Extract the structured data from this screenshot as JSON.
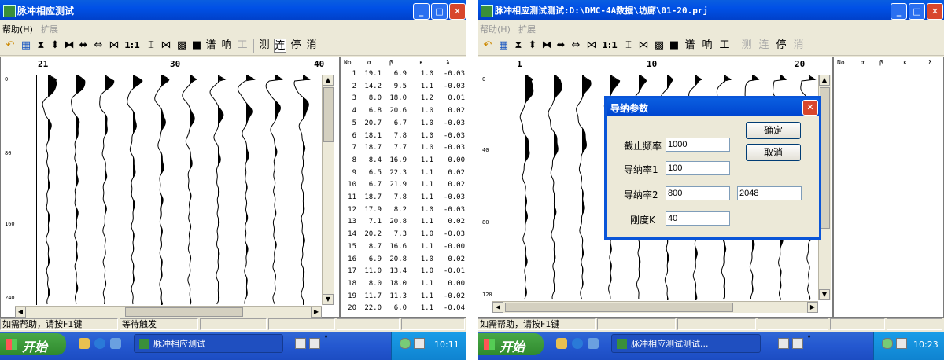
{
  "left": {
    "title": "脉冲相应测试",
    "menu": [
      {
        "label": "帮助(H)",
        "enabled": true
      },
      {
        "label": "扩展",
        "enabled": false
      }
    ],
    "toolbar_text": [
      {
        "label": "谱",
        "enabled": true
      },
      {
        "label": "响",
        "enabled": true
      },
      {
        "label": "工",
        "enabled": false
      },
      {
        "label": "测",
        "enabled": true
      },
      {
        "label": "连",
        "enabled": true
      },
      {
        "label": "停",
        "enabled": true
      },
      {
        "label": "消",
        "enabled": true
      }
    ],
    "ratio_label": "1:1",
    "ruler_top": [
      "21",
      "30",
      "40"
    ],
    "ruler_left": [
      "0",
      "80",
      "160",
      "240"
    ],
    "table_headers": [
      "No",
      "α",
      "β",
      "κ",
      "λ"
    ],
    "table_rows": [
      [
        "1",
        "19.1",
        "6.9",
        "1.0",
        "-0.03"
      ],
      [
        "2",
        "14.2",
        "9.5",
        "1.1",
        "-0.03"
      ],
      [
        "3",
        "8.0",
        "18.0",
        "1.2",
        "0.01"
      ],
      [
        "4",
        "6.8",
        "20.6",
        "1.0",
        "0.02"
      ],
      [
        "5",
        "20.7",
        "6.7",
        "1.0",
        "-0.03"
      ],
      [
        "6",
        "18.1",
        "7.8",
        "1.0",
        "-0.03"
      ],
      [
        "7",
        "18.7",
        "7.7",
        "1.0",
        "-0.03"
      ],
      [
        "8",
        "8.4",
        "16.9",
        "1.1",
        "0.00"
      ],
      [
        "9",
        "6.5",
        "22.3",
        "1.1",
        "0.02"
      ],
      [
        "10",
        "6.7",
        "21.9",
        "1.1",
        "0.02"
      ],
      [
        "11",
        "18.7",
        "7.8",
        "1.1",
        "-0.03"
      ],
      [
        "12",
        "17.9",
        "8.2",
        "1.0",
        "-0.03"
      ],
      [
        "13",
        "7.1",
        "20.8",
        "1.1",
        "0.02"
      ],
      [
        "14",
        "20.2",
        "7.3",
        "1.0",
        "-0.03"
      ],
      [
        "15",
        "8.7",
        "16.6",
        "1.1",
        "-0.00"
      ],
      [
        "16",
        "6.9",
        "20.8",
        "1.0",
        "0.02"
      ],
      [
        "17",
        "11.0",
        "13.4",
        "1.0",
        "-0.01"
      ],
      [
        "18",
        "8.0",
        "18.0",
        "1.1",
        "0.00"
      ],
      [
        "19",
        "11.7",
        "11.3",
        "1.1",
        "-0.02"
      ],
      [
        "20",
        "22.0",
        "6.0",
        "1.1",
        "-0.04"
      ]
    ],
    "status": [
      "如需帮助，请按F1键",
      "等待触发"
    ],
    "start_label": "开始",
    "task_label": "脉冲相应测试",
    "clock": "10:11"
  },
  "right": {
    "title": "脉冲相应测试测试:D:\\DMC-4A数据\\坊廊\\01-20.prj",
    "menu": [
      {
        "label": "帮助(H)",
        "enabled": false
      },
      {
        "label": "扩展",
        "enabled": false
      }
    ],
    "toolbar_text": [
      {
        "label": "谱",
        "enabled": true
      },
      {
        "label": "响",
        "enabled": true
      },
      {
        "label": "工",
        "enabled": true
      },
      {
        "label": "测",
        "enabled": false
      },
      {
        "label": "连",
        "enabled": false
      },
      {
        "label": "停",
        "enabled": true
      },
      {
        "label": "消",
        "enabled": false
      }
    ],
    "ratio_label": "1:1",
    "ruler_top": [
      "1",
      "10",
      "20"
    ],
    "ruler_left": [
      "0",
      "40",
      "80",
      "120"
    ],
    "table_headers": [
      "No",
      "α",
      "β",
      "κ",
      "λ"
    ],
    "status": [
      "如需帮助，请按F1键"
    ],
    "start_label": "开始",
    "task_label": "脉冲相应测试测试...",
    "clock": "10:23",
    "dialog": {
      "title": "导纳参数",
      "labels": {
        "cutoff": "截止频率",
        "adm1": "导纳率1",
        "adm2": "导纳率2",
        "stiffness": "刚度K"
      },
      "values": {
        "cutoff": "1000",
        "adm1": "100",
        "adm2": "800",
        "adm2b": "2048",
        "stiffness": "40"
      },
      "ok": "确定",
      "cancel": "取消"
    }
  }
}
